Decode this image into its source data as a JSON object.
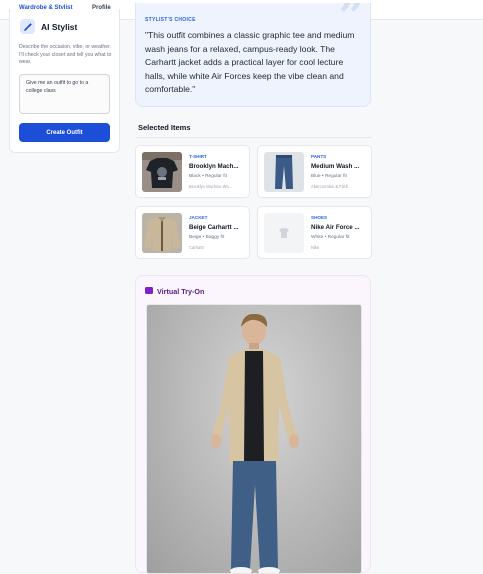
{
  "nav": {
    "tabs": [
      {
        "label": "Wardrobe & Stylist",
        "active": true
      },
      {
        "label": "Profile",
        "active": false
      }
    ]
  },
  "stylist": {
    "title": "AI Stylist",
    "description": "Describe the occasion, vibe, or weather. I'll check your closet and tell you what to wear.",
    "prompt_value": "Give me an outfit to go to a college class",
    "button_label": "Create Outfit"
  },
  "quote": {
    "eyebrow": "STYLIST'S CHOICE",
    "text": "\"This outfit combines a classic graphic tee and medium wash jeans for a relaxed, campus-ready look. The Carhartt jacket adds a practical layer for cool lecture halls, while white Air Forces keep the vibe clean and comfortable.\""
  },
  "selected": {
    "title": "Selected Items",
    "items": [
      {
        "category": "T-SHIRT",
        "name": "Brooklyn Mach...",
        "meta": "Black • Regular fit",
        "brand": "Brooklyn Machine Wo..."
      },
      {
        "category": "PANTS",
        "name": "Medium Wash ...",
        "meta": "Blue • Regular fit",
        "brand": "Abercrombie & Fitch"
      },
      {
        "category": "JACKET",
        "name": "Beige Carhartt ...",
        "meta": "Beige • Baggy fit",
        "brand": "Carhartt"
      },
      {
        "category": "SHOES",
        "name": "Nike Air Force ...",
        "meta": "White • Regular fit",
        "brand": "Nike"
      }
    ]
  },
  "tryon": {
    "title": "Virtual Try-On"
  },
  "icons": {
    "stylist": "magic-wand-icon",
    "tryon": "camera-icon",
    "quote": "quote-icon",
    "placeholder": "tshirt-placeholder-icon"
  },
  "colors": {
    "accent": "#2563eb",
    "button": "#1d4ed8",
    "quote_bg": "#eef3fd",
    "tryon_bg": "#fbf6fd",
    "tryon_title": "#581c87"
  }
}
